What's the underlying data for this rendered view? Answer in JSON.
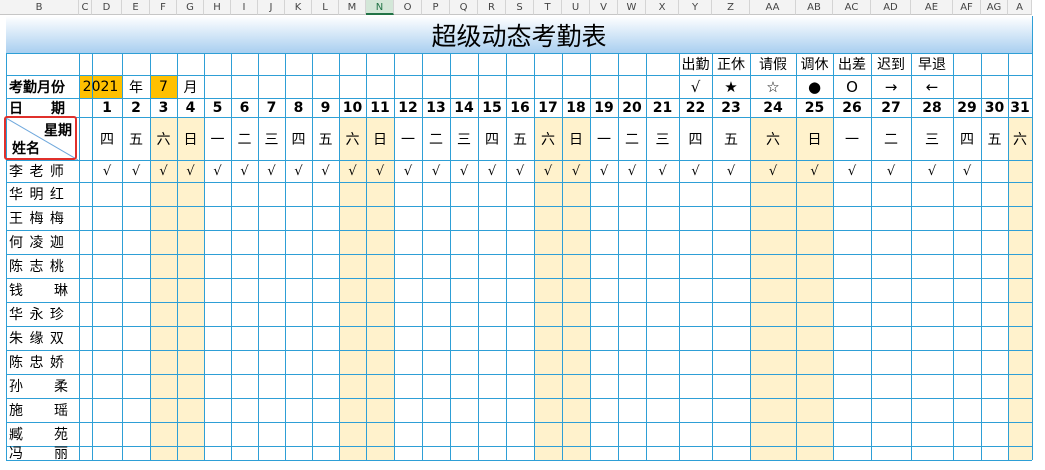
{
  "col_headers": [
    "B",
    "C",
    "D",
    "E",
    "F",
    "G",
    "H",
    "I",
    "J",
    "K",
    "L",
    "M",
    "N",
    "O",
    "P",
    "Q",
    "R",
    "S",
    "T",
    "U",
    "V",
    "W",
    "X",
    "Y",
    "Z",
    "AA",
    "AB",
    "AC",
    "AD",
    "AE",
    "AF",
    "AG",
    "A"
  ],
  "selected_column": "N",
  "title": "超级动态考勤表",
  "legend": [
    {
      "label": "出勤",
      "symbol": "√"
    },
    {
      "label": "正休",
      "symbol": "★"
    },
    {
      "label": "请假",
      "symbol": "☆"
    },
    {
      "label": "调休",
      "symbol": "●"
    },
    {
      "label": "出差",
      "symbol": "O"
    },
    {
      "label": "迟到",
      "symbol": "→"
    },
    {
      "label": "早退",
      "symbol": "←"
    }
  ],
  "month_row": {
    "label": "考勤月份",
    "year": "2021",
    "year_unit": "年",
    "month": "7",
    "month_unit": "月"
  },
  "date_row_label": "日　　期",
  "header_cell": {
    "week": "星期",
    "name": "姓名"
  },
  "days": [
    "1",
    "2",
    "3",
    "4",
    "5",
    "6",
    "7",
    "8",
    "9",
    "10",
    "11",
    "12",
    "13",
    "14",
    "15",
    "16",
    "17",
    "18",
    "19",
    "20",
    "21",
    "22",
    "23",
    "24",
    "25",
    "26",
    "27",
    "28",
    "29",
    "30",
    "31"
  ],
  "weekdays": [
    "四",
    "五",
    "六",
    "日",
    "一",
    "二",
    "三",
    "四",
    "五",
    "六",
    "日",
    "一",
    "二",
    "三",
    "四",
    "五",
    "六",
    "日",
    "一",
    "二",
    "三",
    "四",
    "五",
    "六",
    "日",
    "一",
    "二",
    "三",
    "四",
    "五",
    "六"
  ],
  "weekend_flags": [
    0,
    0,
    1,
    1,
    0,
    0,
    0,
    0,
    0,
    1,
    1,
    0,
    0,
    0,
    0,
    0,
    1,
    1,
    0,
    0,
    0,
    0,
    0,
    1,
    1,
    0,
    0,
    0,
    0,
    0,
    1
  ],
  "employees": [
    {
      "name": "李 老 师",
      "marks": [
        "√",
        "√",
        "√",
        "√",
        "√",
        "√",
        "√",
        "√",
        "√",
        "√",
        "√",
        "√",
        "√",
        "√",
        "√",
        "√",
        "√",
        "√",
        "√",
        "√",
        "√",
        "√",
        "√",
        "√",
        "√",
        "√",
        "√",
        "√",
        "√",
        "",
        ""
      ]
    },
    {
      "name": "华 明 红",
      "marks": []
    },
    {
      "name": "王 梅 梅",
      "marks": []
    },
    {
      "name": "何 凌 迦",
      "marks": []
    },
    {
      "name": "陈 志 桃",
      "marks": []
    },
    {
      "name": "钱　　琳",
      "marks": []
    },
    {
      "name": "华 永 珍",
      "marks": []
    },
    {
      "name": "朱 缘 双",
      "marks": []
    },
    {
      "name": "陈 忠 娇",
      "marks": []
    },
    {
      "name": "孙　　柔",
      "marks": []
    },
    {
      "name": "施　　瑶",
      "marks": []
    },
    {
      "name": "臧　　苑",
      "marks": []
    },
    {
      "name": "冯　　丽",
      "marks": []
    }
  ]
}
